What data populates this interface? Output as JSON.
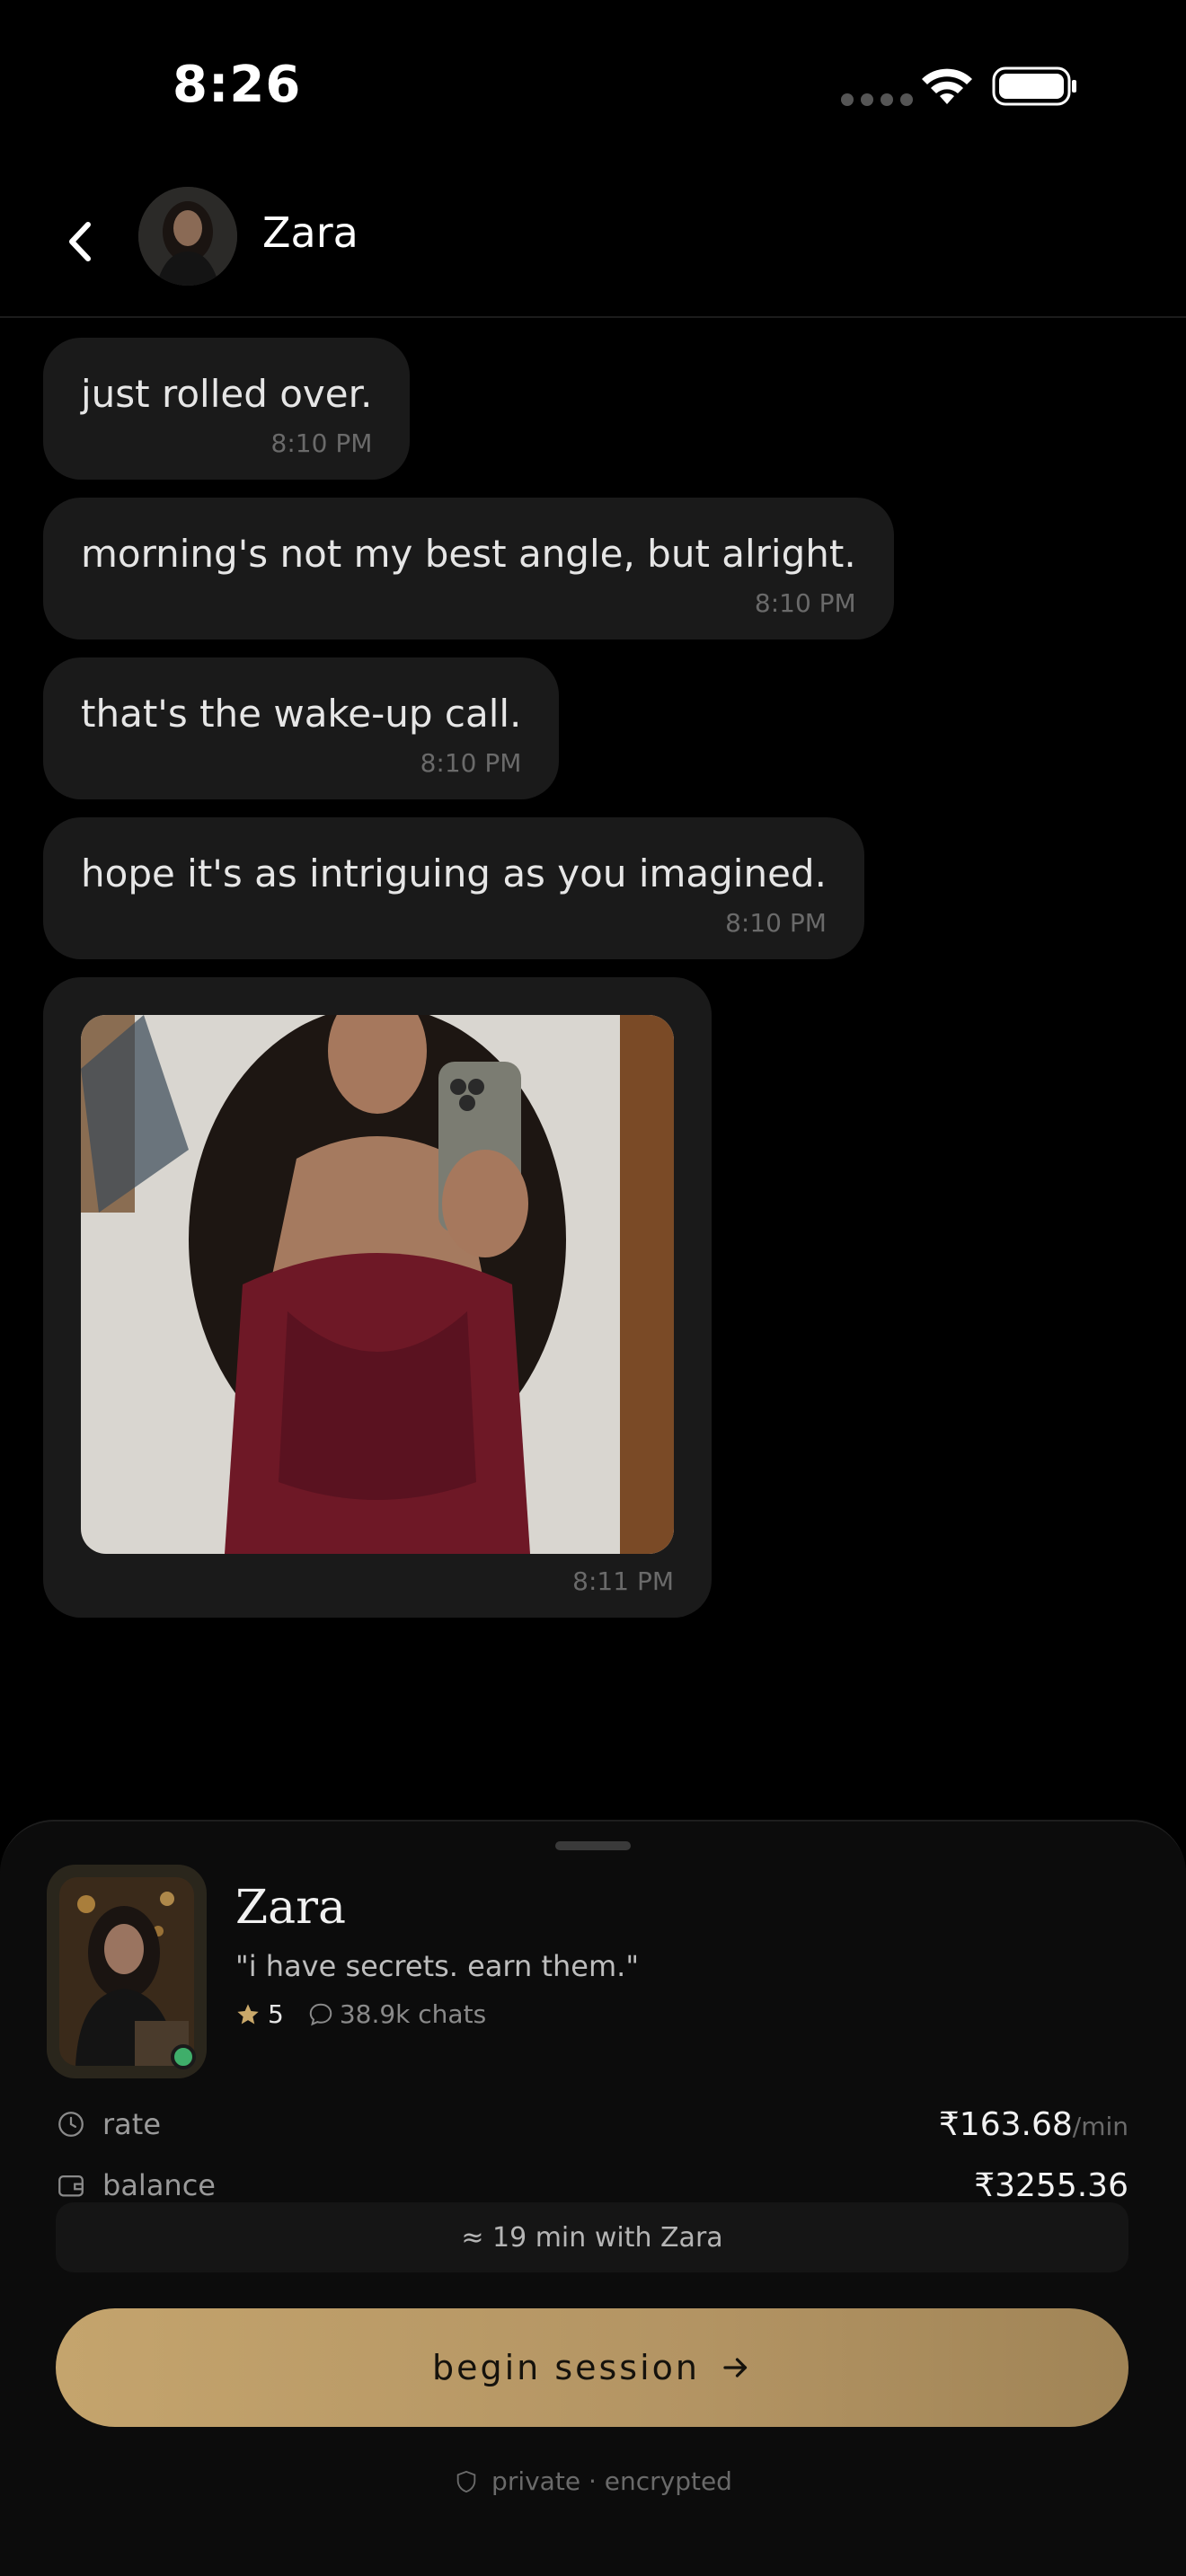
{
  "status_bar": {
    "time": "8:26"
  },
  "header": {
    "name": "Zara"
  },
  "messages": [
    {
      "text": "just rolled over.",
      "time": "8:10 PM"
    },
    {
      "text": "morning's not my best angle, but alright.",
      "time": "8:10 PM"
    },
    {
      "text": "that's the wake-up call.",
      "time": "8:10 PM"
    },
    {
      "text": "hope it's as intriguing as you imagined.",
      "time": "8:10 PM"
    },
    {
      "type": "image",
      "time": "8:11 PM"
    }
  ],
  "profile": {
    "name": "Zara",
    "tagline": "\"i have secrets. earn them.\"",
    "rating": "5",
    "chats": "38.9k chats",
    "online": true
  },
  "rate": {
    "label": "rate",
    "value": "₹163.68",
    "unit": "/min"
  },
  "balance": {
    "label": "balance",
    "value": "₹3255.36"
  },
  "estimate": "≈ 19 min with Zara",
  "cta": {
    "label": "begin session"
  },
  "privacy": "private · encrypted",
  "colors": {
    "background": "#000000",
    "bubble": "#1a1a1a",
    "accent_gold": "#c4a46d",
    "online": "#3fae6a"
  }
}
